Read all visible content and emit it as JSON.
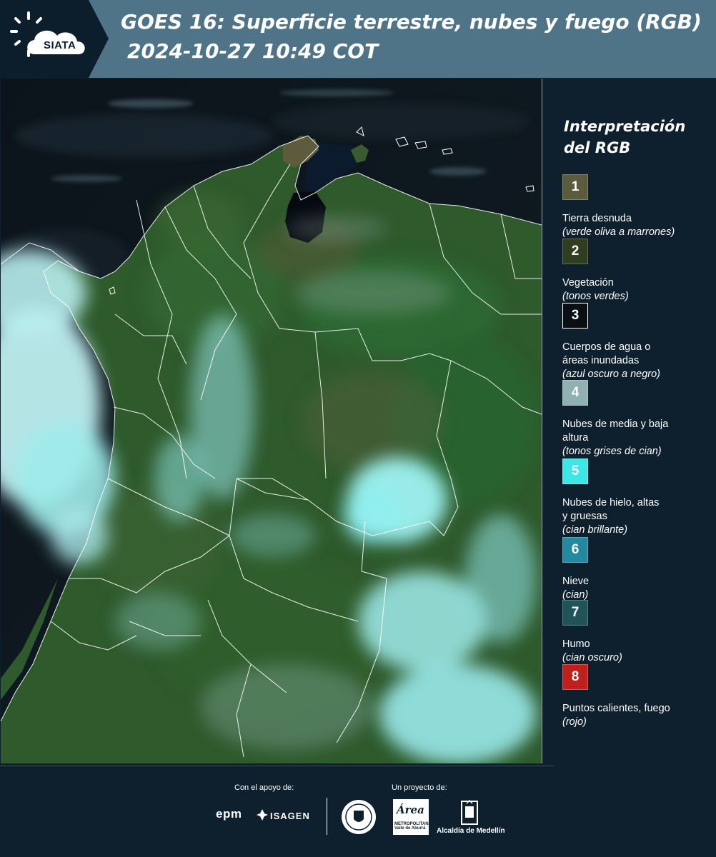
{
  "header": {
    "logo_text": "SIATA",
    "title_line1": "GOES 16: Superficie terrestre, nubes y fuego (RGB)",
    "title_line2": "2024-10-27 10:49 COT"
  },
  "map": {
    "satellite": "GOES 16",
    "product": "RGB superficie terrestre, nubes y fuego"
  },
  "legend": {
    "title": "Interpretación del RGB",
    "items": [
      {
        "number": "1",
        "label": "Tierra desnuda",
        "sub": "(verde oliva a marrones)",
        "color": "#5b5b3e"
      },
      {
        "number": "2",
        "label": "Vegetación",
        "sub": "(tonos verdes)",
        "color": "#2f3e1e"
      },
      {
        "number": "3",
        "label": "Cuerpos de agua o áreas inundadas",
        "sub": "(azul oscuro a negro)",
        "color": "#0a0f14"
      },
      {
        "number": "4",
        "label": "Nubes de media y baja altura",
        "sub": "(tonos grises de cian)",
        "color": "#8fb1b1"
      },
      {
        "number": "5",
        "label": "Nubes de hielo, altas y gruesas",
        "sub": "(cian brillante)",
        "color": "#3fe6e6"
      },
      {
        "number": "6",
        "label": "Nieve",
        "sub": "(cian)",
        "color": "#22899f"
      },
      {
        "number": "7",
        "label": "Humo",
        "sub": "(cian oscuro)",
        "color": "#1f5459"
      },
      {
        "number": "8",
        "label": "Puntos calientes, fuego",
        "sub": "(rojo)",
        "color": "#c0201c"
      }
    ]
  },
  "footer": {
    "support_label": "Con el apoyo de:",
    "project_label": "Un proyecto de:",
    "sponsors": {
      "epm": "epm",
      "isagen": "ISAGEN"
    },
    "area_logo": {
      "name": "Área",
      "sub": "METROPOLITANA Valle de Aburrá"
    },
    "alcaldia": "Alcaldía de Medellín"
  }
}
